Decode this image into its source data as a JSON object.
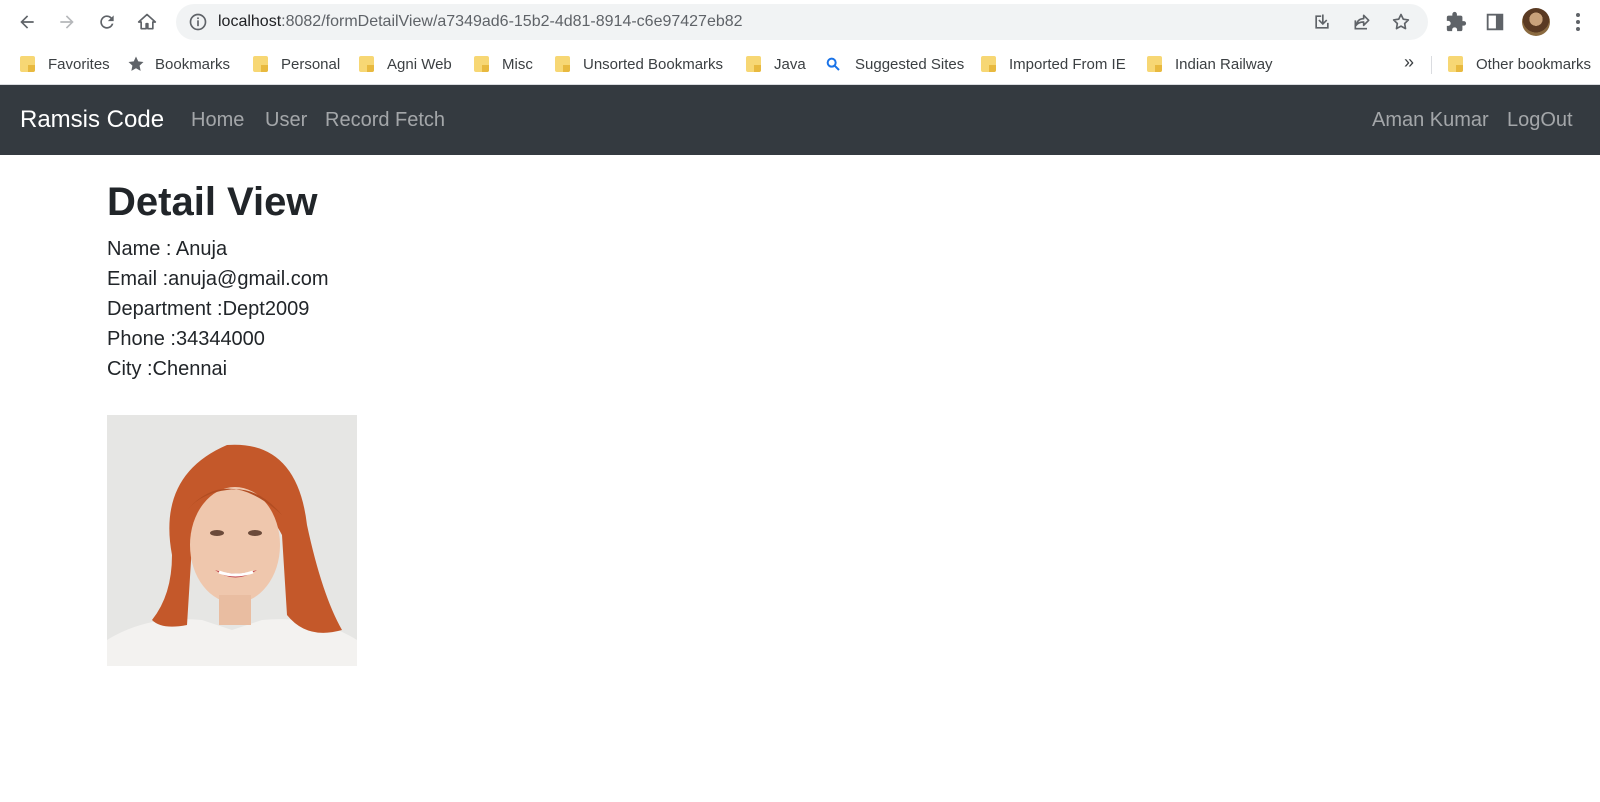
{
  "browser": {
    "url_host": "localhost",
    "url_path": ":8082/formDetailView/a7349ad6-15b2-4d81-8914-c6e97427eb82",
    "bookmarks": [
      {
        "label": "Favorites",
        "icon": "folder-icon"
      },
      {
        "label": "Bookmarks",
        "icon": "star-icon"
      },
      {
        "label": "Personal",
        "icon": "folder-icon"
      },
      {
        "label": "Agni Web",
        "icon": "folder-icon"
      },
      {
        "label": "Misc",
        "icon": "folder-icon"
      },
      {
        "label": "Unsorted Bookmarks",
        "icon": "folder-icon"
      },
      {
        "label": "Java",
        "icon": "folder-icon"
      },
      {
        "label": "Suggested Sites",
        "icon": "search-icon"
      },
      {
        "label": "Imported From IE",
        "icon": "folder-icon"
      },
      {
        "label": "Indian Railway",
        "icon": "folder-icon"
      }
    ],
    "more_chevron": "»",
    "other_bookmarks": "Other bookmarks"
  },
  "navbar": {
    "brand": "Ramsis Code",
    "links": [
      "Home",
      "User",
      "Record Fetch"
    ],
    "user_name": "Aman Kumar",
    "logout": "LogOut",
    "bg_color": "#343a40"
  },
  "detail": {
    "title": "Detail View",
    "name": "Name : Anuja",
    "email": "Email :anuja@gmail.com",
    "department": "Department :Dept2009",
    "phone": "Phone :34344000",
    "city": "City :Chennai"
  }
}
